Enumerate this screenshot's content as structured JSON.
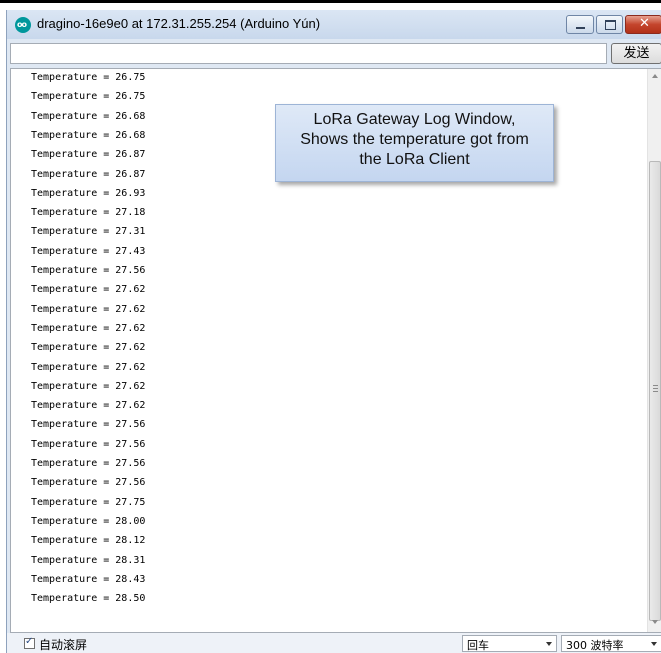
{
  "window": {
    "title": "dragino-16e9e0 at 172.31.255.254 (Arduino Yún)",
    "icon": "arduino-icon"
  },
  "toolbar": {
    "send_input_value": "",
    "send_label": "发送"
  },
  "log": {
    "lines": [
      "Temperature = 26.75",
      "Temperature = 26.75",
      "Temperature = 26.68",
      "Temperature = 26.68",
      "Temperature = 26.87",
      "Temperature = 26.87",
      "Temperature = 26.93",
      "Temperature = 27.18",
      "Temperature = 27.31",
      "Temperature = 27.43",
      "Temperature = 27.56",
      "Temperature = 27.62",
      "Temperature = 27.62",
      "Temperature = 27.62",
      "Temperature = 27.62",
      "Temperature = 27.62",
      "Temperature = 27.62",
      "Temperature = 27.62",
      "Temperature = 27.56",
      "Temperature = 27.56",
      "Temperature = 27.56",
      "Temperature = 27.56",
      "Temperature = 27.75",
      "Temperature = 28.00",
      "Temperature = 28.12",
      "Temperature = 28.31",
      "Temperature = 28.43",
      "Temperature = 28.50"
    ]
  },
  "annotation": {
    "line1": "LoRa Gateway Log Window,",
    "line2": "Shows the temperature got from",
    "line3": "the LoRa Client"
  },
  "statusbar": {
    "autoscroll_checked": true,
    "autoscroll_label": "自动滚屏",
    "line_ending": "回车",
    "baud_rate": "300 波特率"
  },
  "colors": {
    "title_bar": "#c8d8ec",
    "close_button": "#c4442c",
    "callout": "#c4d6f0",
    "arduino_teal": "#00979c"
  }
}
